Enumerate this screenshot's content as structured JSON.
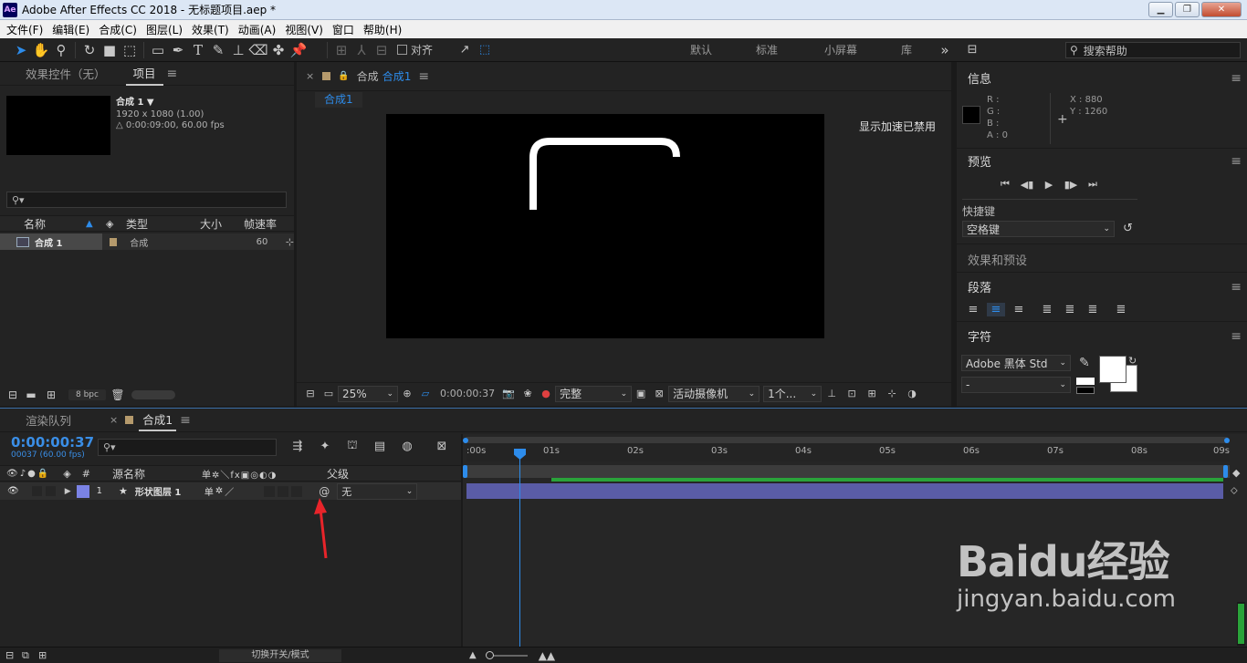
{
  "app": {
    "title": "Adobe After Effects CC 2018 - 无标题项目.aep *",
    "logo": "Ae"
  },
  "window_buttons": [
    "minimize-icon",
    "restore-icon",
    "close-icon"
  ],
  "menu": [
    "文件(F)",
    "编辑(E)",
    "合成(C)",
    "图层(L)",
    "效果(T)",
    "动画(A)",
    "视图(V)",
    "窗口",
    "帮助(H)"
  ],
  "toolbar": {
    "snap_label": "对齐",
    "workspaces": [
      "默认",
      "标准",
      "小屏幕",
      "库"
    ],
    "more": "»",
    "search_placeholder": "搜索帮助"
  },
  "project_panel": {
    "tabs": [
      "效果控件（无）",
      "项目"
    ],
    "comp_name": "合成 1 ▼",
    "comp_size": "1920 x 1080 (1.00)",
    "comp_duration": "△ 0:00:09:00, 60.00 fps",
    "columns": [
      "名称",
      "类型",
      "大小",
      "帧速率"
    ],
    "row": {
      "name": "合成 1",
      "type": "合成",
      "size": "",
      "fps": "60"
    },
    "bpc": "8 bpc"
  },
  "comp_viewer": {
    "tab_label": "合成",
    "tab_name": "合成1",
    "breadcrumb": "合成1",
    "gpu_notice": "显示加速已禁用",
    "zoom": "25%",
    "timecode": "0:00:00:37",
    "resolution": "完整",
    "camera": "活动摄像机",
    "views": "1个..."
  },
  "right_panel": {
    "info": {
      "title": "信息",
      "r": "R :",
      "g": "G :",
      "b": "B :",
      "a": "A : 0",
      "x": "X : 880",
      "y": "Y : 1260"
    },
    "preview": {
      "title": "预览",
      "shortcut_label": "快捷键",
      "shortcut_value": "空格键"
    },
    "effects_title": "效果和预设",
    "paragraph_title": "段落",
    "character": {
      "title": "字符",
      "font": "Adobe 黑体 Std",
      "style": "-"
    }
  },
  "timeline": {
    "tabs": [
      "渲染队列",
      "合成1"
    ],
    "timecode": "0:00:00:37",
    "fps_line": "00037 (60.00 fps)",
    "columns": {
      "num": "#",
      "source": "源名称",
      "switches": "单✲＼fx▣◎◐◑",
      "parent": "父级"
    },
    "layer": {
      "index": "1",
      "name": "形状图层 1",
      "parent": "无"
    },
    "ruler_labels": [
      ":00s",
      "01s",
      "02s",
      "03s",
      "04s",
      "05s",
      "06s",
      "07s",
      "08s",
      "09s"
    ],
    "footer_toggle": "切换开关/模式"
  },
  "watermark": {
    "brand": "Baidu经验",
    "url": "jingyan.baidu.com"
  },
  "colors": {
    "accent_blue": "#2d8ceb",
    "layer_bar": "#5a5ca6",
    "layer_label": "#7b83e5",
    "work_area_green": "#2aa33a",
    "annotation_red": "#e8242a"
  }
}
